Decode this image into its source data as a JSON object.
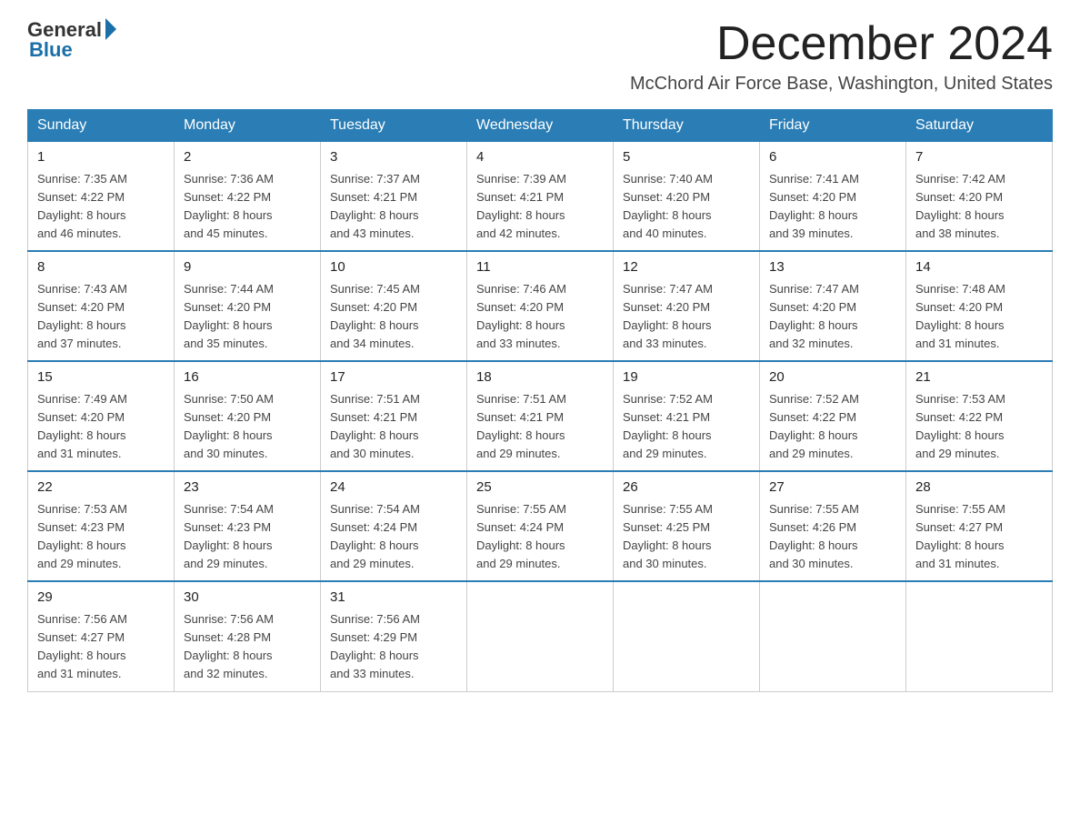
{
  "header": {
    "logo_general": "General",
    "logo_blue": "Blue",
    "title": "December 2024",
    "location": "McChord Air Force Base, Washington, United States"
  },
  "days_of_week": [
    "Sunday",
    "Monday",
    "Tuesday",
    "Wednesday",
    "Thursday",
    "Friday",
    "Saturday"
  ],
  "weeks": [
    [
      {
        "day": "1",
        "sunrise": "7:35 AM",
        "sunset": "4:22 PM",
        "daylight": "8 hours and 46 minutes."
      },
      {
        "day": "2",
        "sunrise": "7:36 AM",
        "sunset": "4:22 PM",
        "daylight": "8 hours and 45 minutes."
      },
      {
        "day": "3",
        "sunrise": "7:37 AM",
        "sunset": "4:21 PM",
        "daylight": "8 hours and 43 minutes."
      },
      {
        "day": "4",
        "sunrise": "7:39 AM",
        "sunset": "4:21 PM",
        "daylight": "8 hours and 42 minutes."
      },
      {
        "day": "5",
        "sunrise": "7:40 AM",
        "sunset": "4:20 PM",
        "daylight": "8 hours and 40 minutes."
      },
      {
        "day": "6",
        "sunrise": "7:41 AM",
        "sunset": "4:20 PM",
        "daylight": "8 hours and 39 minutes."
      },
      {
        "day": "7",
        "sunrise": "7:42 AM",
        "sunset": "4:20 PM",
        "daylight": "8 hours and 38 minutes."
      }
    ],
    [
      {
        "day": "8",
        "sunrise": "7:43 AM",
        "sunset": "4:20 PM",
        "daylight": "8 hours and 37 minutes."
      },
      {
        "day": "9",
        "sunrise": "7:44 AM",
        "sunset": "4:20 PM",
        "daylight": "8 hours and 35 minutes."
      },
      {
        "day": "10",
        "sunrise": "7:45 AM",
        "sunset": "4:20 PM",
        "daylight": "8 hours and 34 minutes."
      },
      {
        "day": "11",
        "sunrise": "7:46 AM",
        "sunset": "4:20 PM",
        "daylight": "8 hours and 33 minutes."
      },
      {
        "day": "12",
        "sunrise": "7:47 AM",
        "sunset": "4:20 PM",
        "daylight": "8 hours and 33 minutes."
      },
      {
        "day": "13",
        "sunrise": "7:47 AM",
        "sunset": "4:20 PM",
        "daylight": "8 hours and 32 minutes."
      },
      {
        "day": "14",
        "sunrise": "7:48 AM",
        "sunset": "4:20 PM",
        "daylight": "8 hours and 31 minutes."
      }
    ],
    [
      {
        "day": "15",
        "sunrise": "7:49 AM",
        "sunset": "4:20 PM",
        "daylight": "8 hours and 31 minutes."
      },
      {
        "day": "16",
        "sunrise": "7:50 AM",
        "sunset": "4:20 PM",
        "daylight": "8 hours and 30 minutes."
      },
      {
        "day": "17",
        "sunrise": "7:51 AM",
        "sunset": "4:21 PM",
        "daylight": "8 hours and 30 minutes."
      },
      {
        "day": "18",
        "sunrise": "7:51 AM",
        "sunset": "4:21 PM",
        "daylight": "8 hours and 29 minutes."
      },
      {
        "day": "19",
        "sunrise": "7:52 AM",
        "sunset": "4:21 PM",
        "daylight": "8 hours and 29 minutes."
      },
      {
        "day": "20",
        "sunrise": "7:52 AM",
        "sunset": "4:22 PM",
        "daylight": "8 hours and 29 minutes."
      },
      {
        "day": "21",
        "sunrise": "7:53 AM",
        "sunset": "4:22 PM",
        "daylight": "8 hours and 29 minutes."
      }
    ],
    [
      {
        "day": "22",
        "sunrise": "7:53 AM",
        "sunset": "4:23 PM",
        "daylight": "8 hours and 29 minutes."
      },
      {
        "day": "23",
        "sunrise": "7:54 AM",
        "sunset": "4:23 PM",
        "daylight": "8 hours and 29 minutes."
      },
      {
        "day": "24",
        "sunrise": "7:54 AM",
        "sunset": "4:24 PM",
        "daylight": "8 hours and 29 minutes."
      },
      {
        "day": "25",
        "sunrise": "7:55 AM",
        "sunset": "4:24 PM",
        "daylight": "8 hours and 29 minutes."
      },
      {
        "day": "26",
        "sunrise": "7:55 AM",
        "sunset": "4:25 PM",
        "daylight": "8 hours and 30 minutes."
      },
      {
        "day": "27",
        "sunrise": "7:55 AM",
        "sunset": "4:26 PM",
        "daylight": "8 hours and 30 minutes."
      },
      {
        "day": "28",
        "sunrise": "7:55 AM",
        "sunset": "4:27 PM",
        "daylight": "8 hours and 31 minutes."
      }
    ],
    [
      {
        "day": "29",
        "sunrise": "7:56 AM",
        "sunset": "4:27 PM",
        "daylight": "8 hours and 31 minutes."
      },
      {
        "day": "30",
        "sunrise": "7:56 AM",
        "sunset": "4:28 PM",
        "daylight": "8 hours and 32 minutes."
      },
      {
        "day": "31",
        "sunrise": "7:56 AM",
        "sunset": "4:29 PM",
        "daylight": "8 hours and 33 minutes."
      },
      null,
      null,
      null,
      null
    ]
  ],
  "labels": {
    "sunrise": "Sunrise:",
    "sunset": "Sunset:",
    "daylight": "Daylight:"
  }
}
